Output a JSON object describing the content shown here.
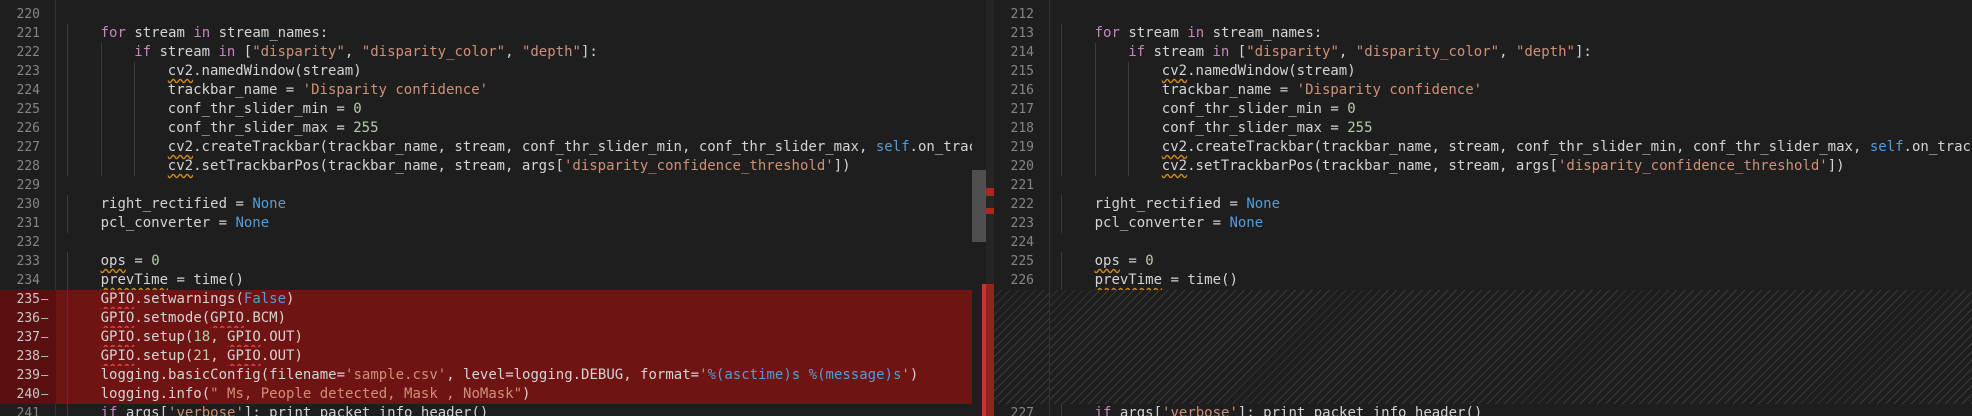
{
  "left": {
    "lines": [
      {
        "n": "220",
        "del": false,
        "i": 0,
        "t": []
      },
      {
        "n": "221",
        "del": false,
        "i": 1,
        "t": [
          [
            "kw",
            "for"
          ],
          [
            "id",
            " stream "
          ],
          [
            "kw",
            "in"
          ],
          [
            "id",
            " stream_names:"
          ]
        ]
      },
      {
        "n": "222",
        "del": false,
        "i": 2,
        "t": [
          [
            "kw",
            "if"
          ],
          [
            "id",
            " stream "
          ],
          [
            "kw",
            "in"
          ],
          [
            "id",
            " ["
          ],
          [
            "str",
            "\"disparity\""
          ],
          [
            "id",
            ", "
          ],
          [
            "str",
            "\"disparity_color\""
          ],
          [
            "id",
            ", "
          ],
          [
            "str",
            "\"depth\""
          ],
          [
            "id",
            "]:"
          ]
        ]
      },
      {
        "n": "223",
        "del": false,
        "i": 3,
        "t": [
          [
            "id",
            "cv2",
            "sq"
          ],
          [
            "id",
            ".namedWindow(stream)"
          ]
        ]
      },
      {
        "n": "224",
        "del": false,
        "i": 3,
        "t": [
          [
            "id",
            "trackbar_name = "
          ],
          [
            "str",
            "'Disparity confidence'"
          ]
        ]
      },
      {
        "n": "225",
        "del": false,
        "i": 3,
        "t": [
          [
            "id",
            "conf_thr_slider_min = "
          ],
          [
            "num",
            "0"
          ]
        ]
      },
      {
        "n": "226",
        "del": false,
        "i": 3,
        "t": [
          [
            "id",
            "conf_thr_slider_max = "
          ],
          [
            "num",
            "255"
          ]
        ]
      },
      {
        "n": "227",
        "del": false,
        "i": 3,
        "t": [
          [
            "id",
            "cv2",
            "sq"
          ],
          [
            "id",
            ".createTrackbar(trackbar_name, stream, conf_thr_slider_min, conf_thr_slider_max, "
          ],
          [
            "kwb",
            "self"
          ],
          [
            "id",
            ".on_trackbar_change)"
          ]
        ]
      },
      {
        "n": "228",
        "del": false,
        "i": 3,
        "t": [
          [
            "id",
            "cv2",
            "sq"
          ],
          [
            "id",
            ".setTrackbarPos(trackbar_name, stream, args["
          ],
          [
            "str",
            "'disparity_confidence_threshold'"
          ],
          [
            "id",
            "])"
          ]
        ]
      },
      {
        "n": "229",
        "del": false,
        "i": 0,
        "t": []
      },
      {
        "n": "230",
        "del": false,
        "i": 1,
        "t": [
          [
            "id",
            "right_rectified = "
          ],
          [
            "kwb",
            "None"
          ]
        ]
      },
      {
        "n": "231",
        "del": false,
        "i": 1,
        "t": [
          [
            "id",
            "pcl_converter = "
          ],
          [
            "kwb",
            "None"
          ]
        ]
      },
      {
        "n": "232",
        "del": false,
        "i": 0,
        "t": []
      },
      {
        "n": "233",
        "del": false,
        "i": 1,
        "t": [
          [
            "id",
            "ops",
            "sq"
          ],
          [
            "id",
            " = "
          ],
          [
            "num",
            "0"
          ]
        ]
      },
      {
        "n": "234",
        "del": false,
        "i": 1,
        "t": [
          [
            "id",
            "prevTime",
            "sq"
          ],
          [
            "id",
            " = time()"
          ]
        ]
      },
      {
        "n": "235",
        "del": true,
        "i": 1,
        "t": [
          [
            "id",
            "GPIO",
            "sqr"
          ],
          [
            "id",
            ".setwarnings("
          ],
          [
            "kwb",
            "False"
          ],
          [
            "id",
            ")"
          ]
        ]
      },
      {
        "n": "236",
        "del": true,
        "i": 1,
        "t": [
          [
            "id",
            "GPIO",
            "sqr"
          ],
          [
            "id",
            ".setmode("
          ],
          [
            "id",
            "GPIO",
            "sqr"
          ],
          [
            "id",
            ".BCM)"
          ]
        ]
      },
      {
        "n": "237",
        "del": true,
        "i": 1,
        "t": [
          [
            "id",
            "GPIO",
            "sqr"
          ],
          [
            "id",
            ".setup("
          ],
          [
            "num",
            "18"
          ],
          [
            "id",
            ", "
          ],
          [
            "id",
            "GPIO",
            "sqr"
          ],
          [
            "id",
            ".OUT)"
          ]
        ]
      },
      {
        "n": "238",
        "del": true,
        "i": 1,
        "t": [
          [
            "id",
            "GPIO",
            "sqr"
          ],
          [
            "id",
            ".setup("
          ],
          [
            "num",
            "21"
          ],
          [
            "id",
            ", "
          ],
          [
            "id",
            "GPIO",
            "sqr"
          ],
          [
            "id",
            ".OUT)"
          ]
        ]
      },
      {
        "n": "239",
        "del": true,
        "i": 1,
        "t": [
          [
            "id",
            "logging.basicConfig(filename="
          ],
          [
            "str",
            "'sample.csv'"
          ],
          [
            "id",
            ", level=logging.DEBUG, format="
          ],
          [
            "str",
            "'"
          ],
          [
            "fmt",
            "%(asctime)s"
          ],
          [
            "str",
            " "
          ],
          [
            "fmt",
            "%(message)s"
          ],
          [
            "str",
            "'"
          ],
          [
            "id",
            ")"
          ]
        ]
      },
      {
        "n": "240",
        "del": true,
        "i": 1,
        "t": [
          [
            "id",
            "logging.info("
          ],
          [
            "str",
            "\" Ms, People detected, Mask , NoMask\""
          ],
          [
            "id",
            ")"
          ]
        ]
      },
      {
        "n": "241",
        "del": false,
        "i": 1,
        "t": [
          [
            "kw",
            "if"
          ],
          [
            "id",
            " args["
          ],
          [
            "str",
            "'verbose'"
          ],
          [
            "id",
            "]: print_packet_info_header()"
          ]
        ]
      }
    ]
  },
  "right": {
    "lines": [
      {
        "n": "212",
        "i": 0,
        "t": []
      },
      {
        "n": "213",
        "i": 1,
        "t": [
          [
            "kw",
            "for"
          ],
          [
            "id",
            " stream "
          ],
          [
            "kw",
            "in"
          ],
          [
            "id",
            " stream_names:"
          ]
        ]
      },
      {
        "n": "214",
        "i": 2,
        "t": [
          [
            "kw",
            "if"
          ],
          [
            "id",
            " stream "
          ],
          [
            "kw",
            "in"
          ],
          [
            "id",
            " ["
          ],
          [
            "str",
            "\"disparity\""
          ],
          [
            "id",
            ", "
          ],
          [
            "str",
            "\"disparity_color\""
          ],
          [
            "id",
            ", "
          ],
          [
            "str",
            "\"depth\""
          ],
          [
            "id",
            "]:"
          ]
        ]
      },
      {
        "n": "215",
        "i": 3,
        "t": [
          [
            "id",
            "cv2",
            "sq"
          ],
          [
            "id",
            ".namedWindow(stream)"
          ]
        ]
      },
      {
        "n": "216",
        "i": 3,
        "t": [
          [
            "id",
            "trackbar_name = "
          ],
          [
            "str",
            "'Disparity confidence'"
          ]
        ]
      },
      {
        "n": "217",
        "i": 3,
        "t": [
          [
            "id",
            "conf_thr_slider_min = "
          ],
          [
            "num",
            "0"
          ]
        ]
      },
      {
        "n": "218",
        "i": 3,
        "t": [
          [
            "id",
            "conf_thr_slider_max = "
          ],
          [
            "num",
            "255"
          ]
        ]
      },
      {
        "n": "219",
        "i": 3,
        "t": [
          [
            "id",
            "cv2",
            "sq"
          ],
          [
            "id",
            ".createTrackbar(trackbar_name, stream, conf_thr_slider_min, conf_thr_slider_max, "
          ],
          [
            "kwb",
            "self"
          ],
          [
            "id",
            ".on_trackbar_change)"
          ]
        ]
      },
      {
        "n": "220",
        "i": 3,
        "t": [
          [
            "id",
            "cv2",
            "sq"
          ],
          [
            "id",
            ".setTrackbarPos(trackbar_name, stream, args["
          ],
          [
            "str",
            "'disparity_confidence_threshold'"
          ],
          [
            "id",
            "])"
          ]
        ]
      },
      {
        "n": "221",
        "i": 0,
        "t": []
      },
      {
        "n": "222",
        "i": 1,
        "t": [
          [
            "id",
            "right_rectified = "
          ],
          [
            "kwb",
            "None"
          ]
        ]
      },
      {
        "n": "223",
        "i": 1,
        "t": [
          [
            "id",
            "pcl_converter = "
          ],
          [
            "kwb",
            "None"
          ]
        ]
      },
      {
        "n": "224",
        "i": 0,
        "t": []
      },
      {
        "n": "225",
        "i": 1,
        "t": [
          [
            "id",
            "ops",
            "sq"
          ],
          [
            "id",
            " = "
          ],
          [
            "num",
            "0"
          ]
        ]
      },
      {
        "n": "226",
        "i": 1,
        "t": [
          [
            "id",
            "prevTime",
            "sq"
          ],
          [
            "id",
            " = time()"
          ]
        ]
      },
      {
        "n": "",
        "i": 0,
        "t": [],
        "gap": 6
      },
      {
        "n": "227",
        "i": 1,
        "t": [
          [
            "kw",
            "if"
          ],
          [
            "id",
            " args["
          ],
          [
            "str",
            "'verbose'"
          ],
          [
            "id",
            "]: print_packet_info_header()"
          ]
        ]
      }
    ]
  },
  "colors": {
    "deleted_line": "#6f1313",
    "deleted_gutter": "#5a1010",
    "keyword": "#c586c0",
    "builtin": "#569cd6",
    "string": "#ce9178",
    "number": "#b5cea8"
  }
}
